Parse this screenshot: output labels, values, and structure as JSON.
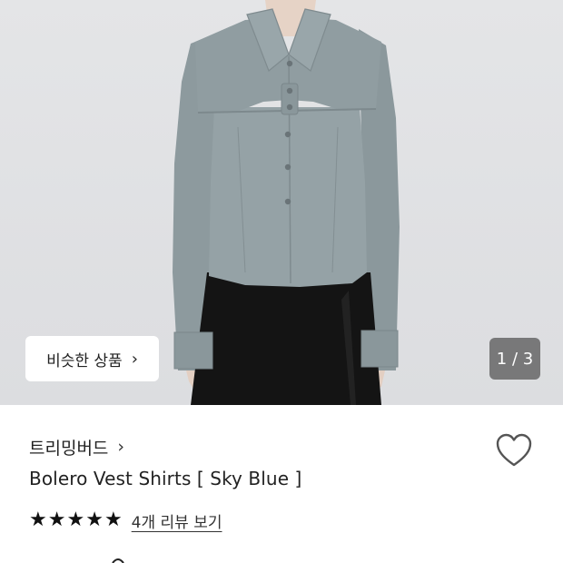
{
  "hero": {
    "similar_button_label": "비슷한 상품",
    "similar_button_chevron": "›",
    "image_counter": "1 / 3"
  },
  "product": {
    "brand": "트리밍버드",
    "brand_chevron": "›",
    "name": "Bolero Vest Shirts [ Sky Blue ]",
    "rating_stars": 5,
    "review_link": "4개 리뷰 보기"
  },
  "icons": {
    "heart": "heart-outline-icon",
    "star": "star-filled-icon"
  },
  "colors": {
    "shirt": "#8e9b9f",
    "skirt": "#151515",
    "background": "#dfe0e2",
    "counter_bg": "#555555"
  }
}
